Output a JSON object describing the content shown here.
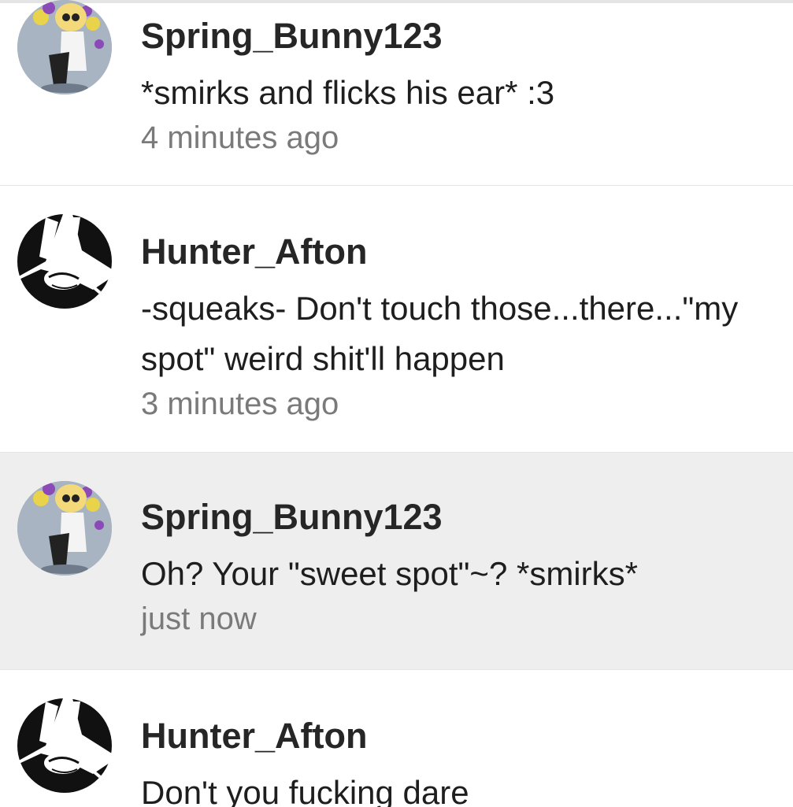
{
  "comments": [
    {
      "username": "Spring_Bunny123",
      "avatar_icon": "spring-bunny-avatar-icon",
      "message": "*smirks and flicks his ear* :3",
      "timestamp": "4 minutes ago",
      "highlighted": false
    },
    {
      "username": "Hunter_Afton",
      "avatar_icon": "hunter-afton-avatar-icon",
      "message": "-squeaks- Don't touch those...there...\"my spot\" weird shit'll happen",
      "timestamp": "3 minutes ago",
      "highlighted": false
    },
    {
      "username": "Spring_Bunny123",
      "avatar_icon": "spring-bunny-avatar-icon",
      "message": "Oh? Your \"sweet spot\"~? *smirks*",
      "timestamp": "just now",
      "highlighted": true
    },
    {
      "username": "Hunter_Afton",
      "avatar_icon": "hunter-afton-avatar-icon",
      "message": "Don't you fucking dare",
      "timestamp": "",
      "highlighted": false
    }
  ],
  "colors": {
    "highlight_background": "#eeeeee",
    "username": "#262626",
    "message": "#1e1e1e",
    "timestamp": "#7a7a7a",
    "divider": "#e6e6e6"
  }
}
